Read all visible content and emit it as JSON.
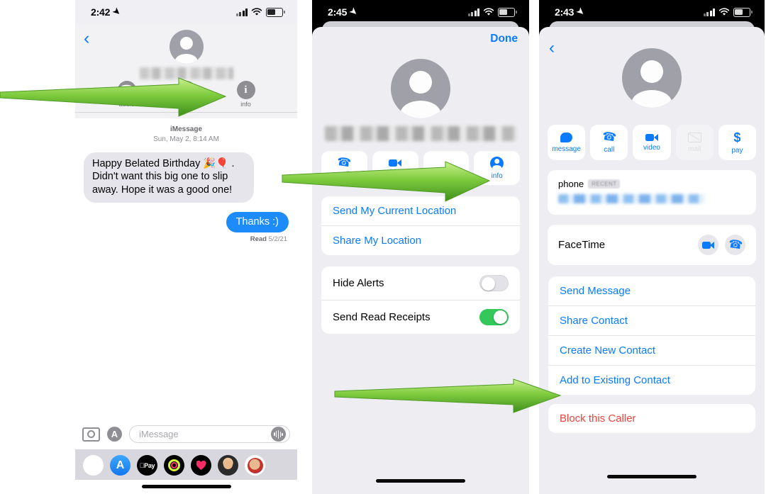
{
  "page": {
    "background": "#ffffff",
    "accent_blue": "#0a7bff",
    "accent_green": "#34c759",
    "danger_red": "#e8453c",
    "arrow_green_light": "#b6e878",
    "arrow_green_dark": "#4aa521"
  },
  "phone1": {
    "status": {
      "time": "2:42",
      "location_icon": "➤",
      "signal_icon": "cellular-bars",
      "wifi_icon": "wifi",
      "battery_icon": "battery"
    },
    "header": {
      "back_icon": "‹",
      "avatar": "contact-avatar-placeholder",
      "contact_name_blurred": "",
      "actions": [
        {
          "label": "audio",
          "icon": "phone-icon"
        },
        {
          "label": "FaceTime",
          "icon": "video-icon"
        },
        {
          "label": "info",
          "icon": "info-icon",
          "glyph": "i"
        }
      ]
    },
    "conversation": {
      "service": "iMessage",
      "timestamp": "Sun, May 2, 8:14 AM",
      "messages": [
        {
          "from": "them",
          "text": "Happy Belated Birthday 🎉🎈 . Didn't want this big one to slip away. Hope it was a good one!"
        },
        {
          "from": "me",
          "text": "Thanks :)"
        }
      ],
      "receipt_label": "Read",
      "receipt_date": "5/2/21"
    },
    "compose": {
      "camera_icon": "camera-icon",
      "appstore_icon": "app-store-icon",
      "placeholder": "iMessage",
      "mic_icon": "audio-waveform-icon"
    },
    "app_drawer": [
      {
        "name": "photos-app-icon"
      },
      {
        "name": "app-store-app-icon"
      },
      {
        "name": "apple-pay-app-icon",
        "label": "Pay"
      },
      {
        "name": "fitness-app-icon"
      },
      {
        "name": "health-app-icon"
      },
      {
        "name": "memoji-icon-1"
      },
      {
        "name": "memoji-icon-2"
      }
    ],
    "home_indicator": "home-bar"
  },
  "phone2": {
    "status": {
      "time": "2:45",
      "location_icon": "➤"
    },
    "done_label": "Done",
    "avatar": "contact-avatar-placeholder",
    "contact_name_blurred": "",
    "quick_actions": [
      {
        "label": "call",
        "icon": "phone-icon"
      },
      {
        "label": "video",
        "icon": "video-icon"
      },
      {
        "label": "",
        "icon": "hidden-icon"
      },
      {
        "label": "info",
        "icon": "person-circle-icon"
      }
    ],
    "location_card": [
      {
        "label": "Send My Current Location"
      },
      {
        "label": "Share My Location"
      }
    ],
    "settings_card": [
      {
        "label": "Hide Alerts",
        "toggle": "off"
      },
      {
        "label": "Send Read Receipts",
        "toggle": "on"
      }
    ],
    "home_indicator": "home-bar"
  },
  "phone3": {
    "status": {
      "time": "2:43",
      "location_icon": "➤"
    },
    "back_icon": "‹",
    "avatar": "contact-avatar-placeholder",
    "quick_actions": [
      {
        "label": "message",
        "icon": "message-bubble-icon",
        "enabled": true
      },
      {
        "label": "call",
        "icon": "phone-icon",
        "enabled": true
      },
      {
        "label": "video",
        "icon": "video-camera-icon",
        "enabled": true
      },
      {
        "label": "mail",
        "icon": "envelope-icon",
        "enabled": false
      },
      {
        "label": "pay",
        "icon": "dollar-sign-icon",
        "enabled": true
      }
    ],
    "phone_card": {
      "label": "phone",
      "badge": "RECENT",
      "number_blurred": ""
    },
    "facetime_card": {
      "label": "FaceTime",
      "video_icon": "video-camera-icon",
      "audio_icon": "phone-icon"
    },
    "actions_card": [
      {
        "label": "Send Message"
      },
      {
        "label": "Share Contact"
      },
      {
        "label": "Create New Contact"
      },
      {
        "label": "Add to Existing Contact"
      }
    ],
    "block_card": {
      "label": "Block this Caller"
    },
    "home_indicator": "home-bar"
  },
  "annotations": {
    "arrows": [
      {
        "name": "arrow-to-info-button-phone1"
      },
      {
        "name": "arrow-to-info-button-phone2"
      },
      {
        "name": "arrow-to-block-this-caller"
      }
    ]
  }
}
